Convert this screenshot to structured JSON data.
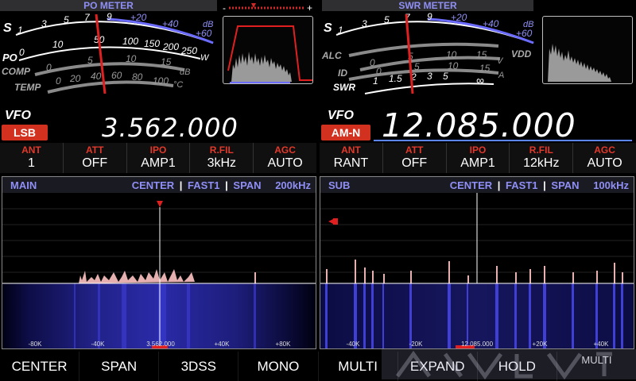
{
  "main_meter": {
    "title": "PO METER",
    "scales": {
      "s": {
        "label": "S",
        "ticks": [
          "1",
          "3",
          "5",
          "7",
          "9",
          "+20",
          "+40",
          "+60"
        ],
        "unit": "dB"
      },
      "po": {
        "label": "PO",
        "ticks": [
          "0",
          "10",
          "50",
          "100",
          "150",
          "200",
          "250"
        ],
        "unit": "W"
      },
      "comp": {
        "label": "COMP",
        "ticks": [
          "0",
          "5",
          "10",
          "15"
        ],
        "unit": "dB"
      },
      "temp": {
        "label": "TEMP",
        "ticks": [
          "0",
          "20",
          "40",
          "60",
          "80",
          "100"
        ],
        "unit": "°C"
      }
    }
  },
  "sub_meter": {
    "title": "SWR METER",
    "scales": {
      "s": {
        "label": "S",
        "ticks": [
          "1",
          "3",
          "5",
          "7",
          "9",
          "+20",
          "+40",
          "+60"
        ],
        "unit": "dB"
      },
      "alc": {
        "label": "ALC"
      },
      "vdd": {
        "label": "VDD",
        "ticks": [
          "0",
          "5",
          "10",
          "15"
        ],
        "unit": "V"
      },
      "id": {
        "label": "ID",
        "ticks": [
          "0",
          "5",
          "10",
          "15"
        ],
        "unit": "A"
      },
      "swr": {
        "label": "SWR",
        "ticks": [
          "1",
          "1.5",
          "2",
          "3",
          "5",
          "∞"
        ]
      }
    }
  },
  "main_vfo": {
    "label": "VFO",
    "mode": "LSB",
    "frequency": "3.562.000"
  },
  "sub_vfo": {
    "label": "VFO",
    "mode": "AM-N",
    "frequency": "12.085.000"
  },
  "main_params": [
    {
      "key": "ANT",
      "value": "1"
    },
    {
      "key": "ATT",
      "value": "OFF"
    },
    {
      "key": "IPO",
      "value": "AMP1"
    },
    {
      "key": "R.FIL",
      "value": "3kHz"
    },
    {
      "key": "AGC",
      "value": "AUTO"
    }
  ],
  "sub_params": [
    {
      "key": "ANT",
      "value": "RANT"
    },
    {
      "key": "ATT",
      "value": "OFF"
    },
    {
      "key": "IPO",
      "value": "AMP1"
    },
    {
      "key": "R.FIL",
      "value": "12kHz"
    },
    {
      "key": "AGC",
      "value": "AUTO"
    }
  ],
  "main_scope": {
    "name": "MAIN",
    "mode": "CENTER",
    "speed": "FAST1",
    "span_label": "SPAN",
    "span": "200kHz",
    "scale": [
      "-80K",
      "-40K",
      "3.562.000",
      "+40K",
      "+80K"
    ]
  },
  "sub_scope": {
    "name": "SUB",
    "mode": "CENTER",
    "speed": "FAST1",
    "span_label": "SPAN",
    "span": "100kHz",
    "scale": [
      "-40K",
      "-20K",
      "12.085.000",
      "+20K",
      "+40K"
    ]
  },
  "bottom_buttons": [
    "CENTER",
    "SPAN",
    "3DSS",
    "MONO",
    "MULTI",
    "EXPAND",
    "HOLD",
    "MULTI"
  ],
  "separator": "|",
  "colors": {
    "accent": "#8f8ff5",
    "mode_badge": "#d2311f",
    "param_key": "#e2392b",
    "needle": "#e02020",
    "waterfall": "#2a2aa8"
  }
}
